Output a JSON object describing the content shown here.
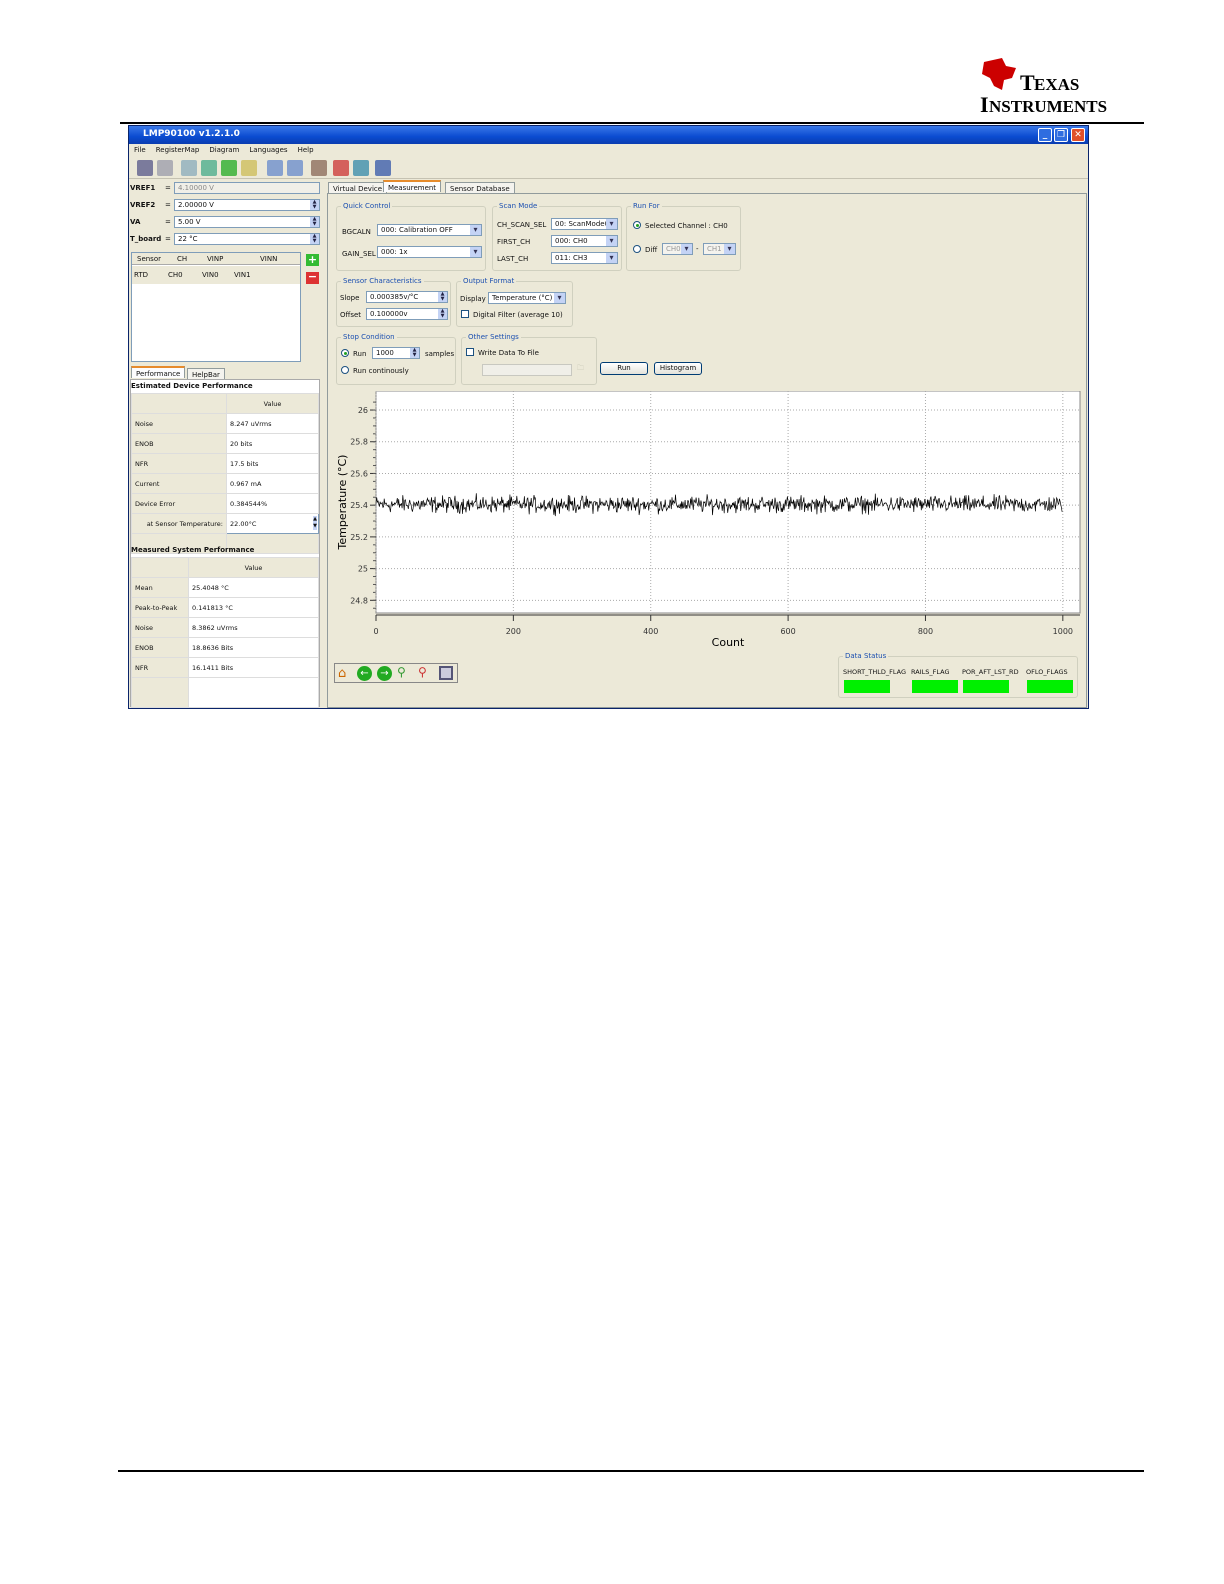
{
  "logo": {
    "text_line1": "Texas",
    "text_line2": "Instruments"
  },
  "window": {
    "title": "LMP90100 v1.2.1.0"
  },
  "menu": [
    "File",
    "RegisterMap",
    "Diagram",
    "Languages",
    "Help"
  ],
  "toolbar_icons": [
    "save-icon",
    "edit-icon",
    "copy-icon",
    "export-icon",
    "refresh-icon",
    "load-icon",
    "zoom-in-icon",
    "zoom-out-icon",
    "settings-icon",
    "pdf-icon",
    "network-icon",
    "help-icon"
  ],
  "left": {
    "vref1": {
      "label": "VREF1",
      "eq": "=",
      "value": "4.10000 V"
    },
    "vref2": {
      "label": "VREF2",
      "eq": "=",
      "value": "2.00000 V"
    },
    "va": {
      "label": "VA",
      "eq": "=",
      "value": "5.00 V"
    },
    "tboard": {
      "label": "T_board",
      "eq": "=",
      "value": "22 °C"
    },
    "sensor_table": {
      "headers": [
        "Sensor",
        "CH",
        "VINP",
        "VINN"
      ],
      "rows": [
        [
          "RTD",
          "CH0",
          "VIN0",
          "VIN1"
        ]
      ]
    },
    "tabs": [
      "Performance",
      "HelpBar"
    ],
    "est_title": "Estimated Device Performance",
    "value_header": "Value",
    "est_rows": [
      [
        "Noise",
        "8.247 uVrms"
      ],
      [
        "ENOB",
        "20 bits"
      ],
      [
        "NFR",
        "17.5 bits"
      ],
      [
        "Current",
        "0.967 mA"
      ],
      [
        "Device Error",
        "0.384544%"
      ]
    ],
    "sensor_temp_label": "at Sensor Temperature:",
    "sensor_temp_value": "22.00°C",
    "meas_title": "Measured System Performance",
    "meas_rows": [
      [
        "Mean",
        "25.4048 °C"
      ],
      [
        "Peak-to-Peak",
        "0.141813 °C"
      ],
      [
        "Noise",
        "8.3862 uVrms"
      ],
      [
        "ENOB",
        "18.8636 Bits"
      ],
      [
        "NFR",
        "16.1411 Bits"
      ]
    ]
  },
  "main": {
    "tabs": [
      "Virtual Device",
      "Measurement",
      "Sensor Database"
    ],
    "quick_control": {
      "title": "Quick Control",
      "bgcaln_label": "BGCALN",
      "bgcaln": "000: Calibration OFF",
      "gain_label": "GAIN_SEL",
      "gain": "000: 1x"
    },
    "scan_mode": {
      "title": "Scan Mode",
      "scan_label": "CH_SCAN_SEL",
      "scan": "00: ScanMode0",
      "first_label": "FIRST_CH",
      "first": "000: CH0",
      "last_label": "LAST_CH",
      "last": "011: CH3"
    },
    "run_for": {
      "title": "Run For",
      "selected": "Selected Channel : CH0",
      "diff": "Diff",
      "diff_a": "CH0",
      "dash": "-",
      "diff_b": "CH1"
    },
    "sensor_char": {
      "title": "Sensor Characteristics",
      "slope_label": "Slope",
      "slope": "0.000385v/°C",
      "offset_label": "Offset",
      "offset": "0.100000v"
    },
    "output_format": {
      "title": "Output Format",
      "display_label": "Display",
      "display": "Temperature (°C)",
      "filter": "Digital Filter (average 10)"
    },
    "stop_condition": {
      "title": "Stop Condition",
      "run": "Run",
      "samples_value": "1000",
      "samples": "samples",
      "continuous": "Run continously"
    },
    "other_settings": {
      "title": "Other Settings",
      "write": "Write Data To File"
    },
    "run_button": "Run",
    "histogram_button": "Histogram",
    "data_status": {
      "title": "Data Status",
      "flags": [
        "SHORT_THLD_FLAG",
        "RAILS_FLAG",
        "POR_AFT_LST_RD",
        "OFLO_FLAGS"
      ],
      "flag_color": "#00f000"
    }
  },
  "chart_data": {
    "type": "line",
    "xlabel": "Count",
    "ylabel": "Temperature (°C)",
    "xlim": [
      0,
      1025
    ],
    "ylim": [
      24.72,
      26.12
    ],
    "xticks": [
      "0",
      "200",
      "400",
      "600",
      "800",
      "1000"
    ],
    "yticks": [
      "24.8",
      "25",
      "25.2",
      "25.4",
      "25.6",
      "25.8",
      "26"
    ],
    "grid": true,
    "n_points": 1000,
    "mean": 25.4048,
    "peak_to_peak": 0.141813,
    "line_color": "#000000"
  }
}
